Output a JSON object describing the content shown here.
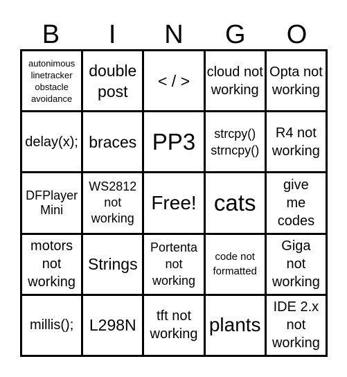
{
  "header": [
    "B",
    "I",
    "N",
    "G",
    "O"
  ],
  "cells": [
    "autonimous linetracker obstacle avoidance",
    "double post",
    "< / >",
    "cloud not working",
    "Opta not working",
    "delay(x);",
    "braces",
    "PP3",
    "strcpy() strncpy()",
    "R4 not working",
    "DFPlayer Mini",
    "WS2812 not working",
    "Free!",
    "cats",
    "give me codes",
    "motors not working",
    "Strings",
    "Portenta not working",
    "code not formatted",
    "Giga not working",
    "millis();",
    "L298N",
    "tft not working",
    "plants",
    "IDE 2.x not working"
  ]
}
